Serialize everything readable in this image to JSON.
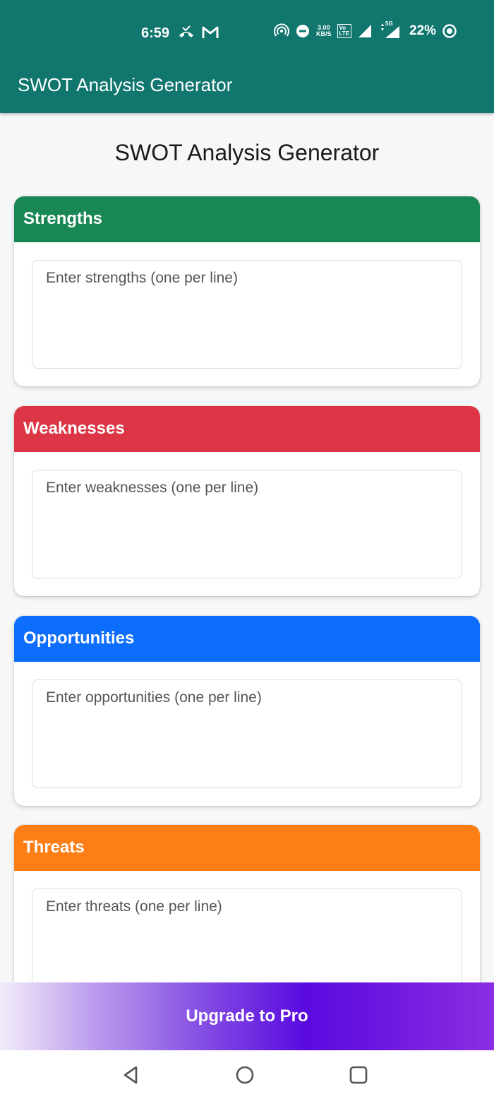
{
  "status_bar": {
    "time": "6:59",
    "net_speed_value": "3.00",
    "net_speed_unit": "KB/S",
    "volte_top": "Vo",
    "volte_bottom": "LTE",
    "network_type": "5G",
    "battery": "22%"
  },
  "app_bar": {
    "title": "SWOT Analysis Generator"
  },
  "page": {
    "heading": "SWOT Analysis Generator"
  },
  "sections": {
    "strengths": {
      "title": "Strengths",
      "placeholder": "Enter strengths (one per line)",
      "color": "#198754"
    },
    "weaknesses": {
      "title": "Weaknesses",
      "placeholder": "Enter weaknesses (one per line)",
      "color": "#dc3545"
    },
    "opportunities": {
      "title": "Opportunities",
      "placeholder": "Enter opportunities (one per line)",
      "color": "#0d6efd"
    },
    "threats": {
      "title": "Threats",
      "placeholder": "Enter threats (one per line)",
      "color": "#fd7e14"
    }
  },
  "upgrade": {
    "label": "Upgrade to Pro"
  },
  "icons": {
    "status_left": [
      "missed-call-icon",
      "gmail-icon"
    ],
    "status_right": [
      "hotspot-icon",
      "do-not-disturb-icon",
      "signal-icon",
      "battery-saver-icon"
    ],
    "navigation": [
      "back-icon",
      "home-icon",
      "recents-icon"
    ]
  },
  "theme": {
    "app_bar": "#10766e",
    "background": "#f6f7f9",
    "upgrade_accent": "#5a0ae0"
  }
}
